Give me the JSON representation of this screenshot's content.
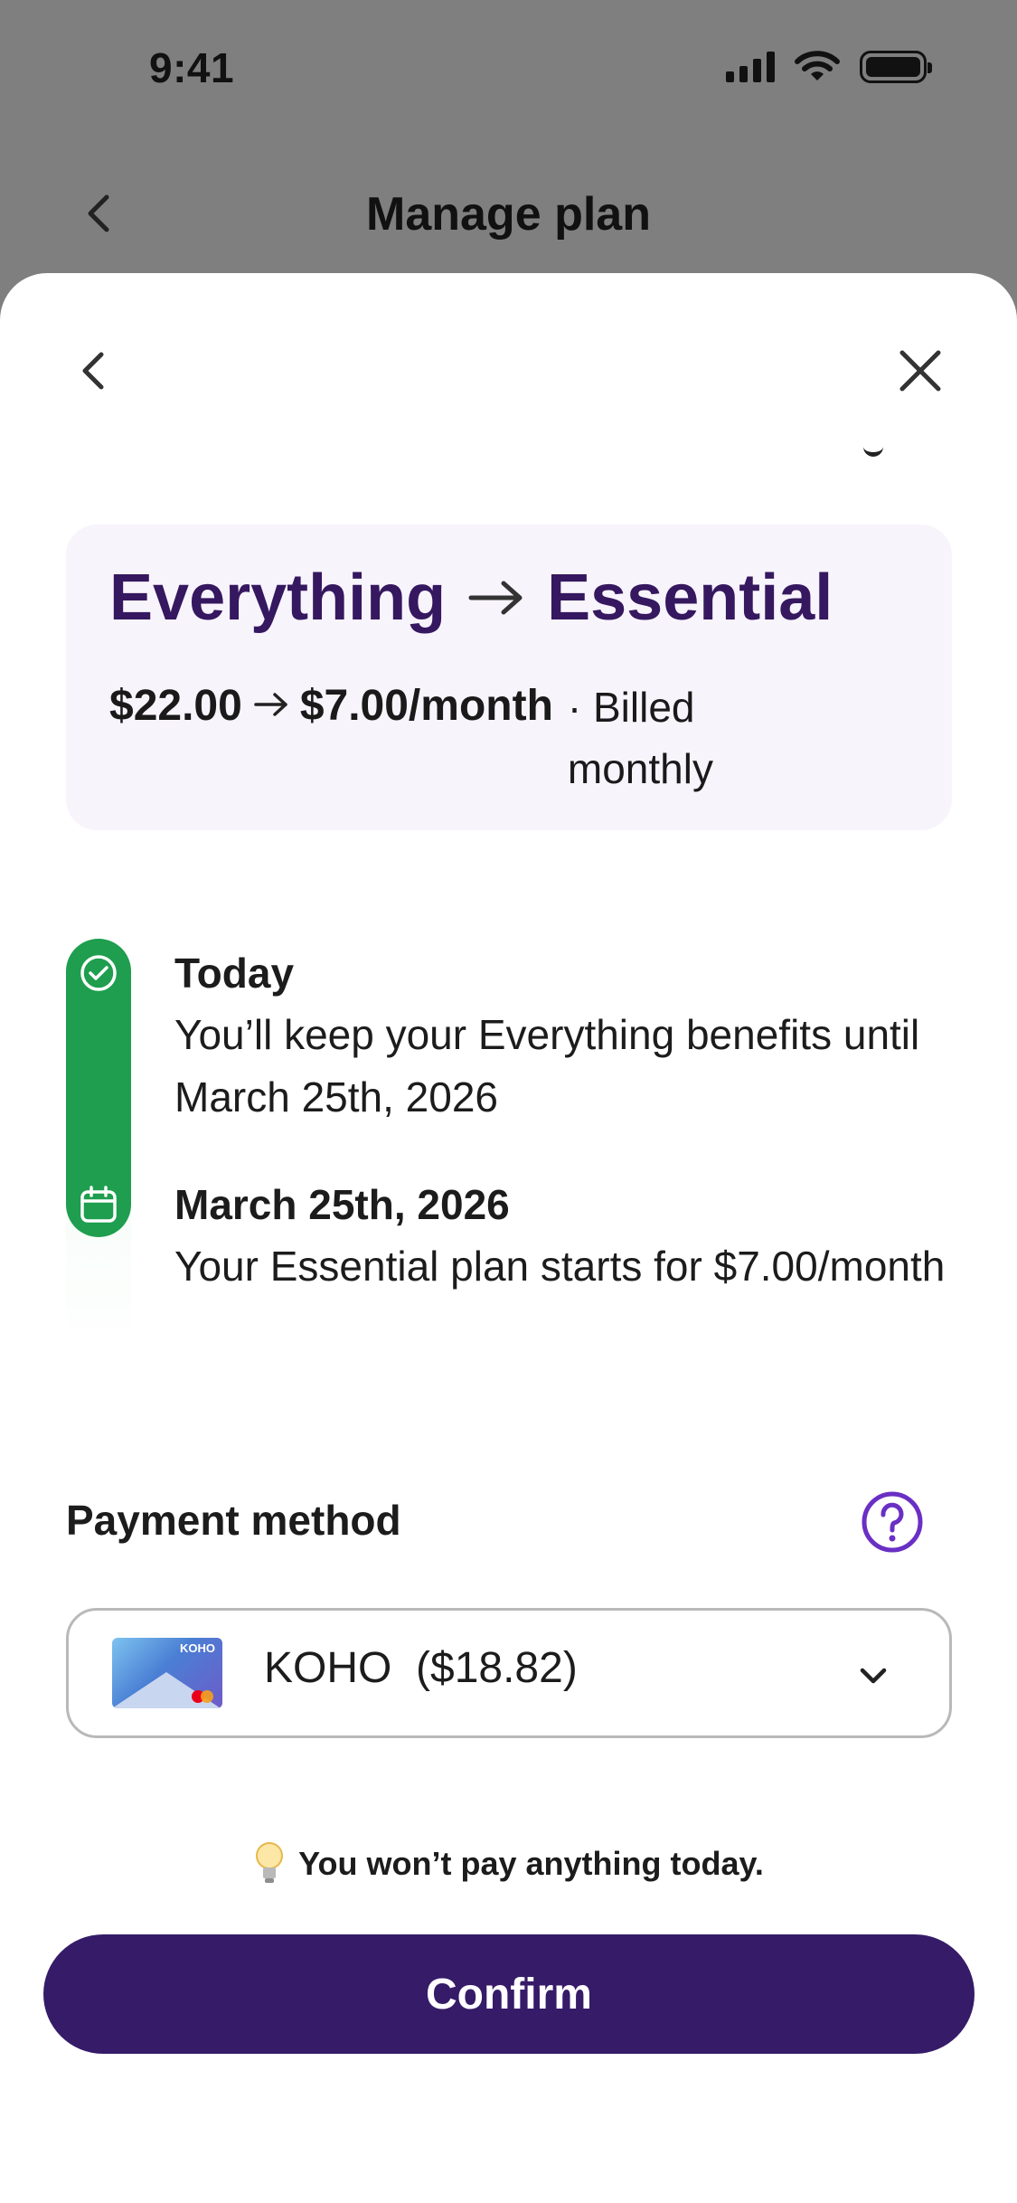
{
  "status_bar": {
    "time": "9:41"
  },
  "background_header": {
    "title": "Manage plan"
  },
  "plan_change": {
    "from_plan": "Everything",
    "to_plan": "Essential",
    "from_price": "$22.00",
    "to_price": "$7.00/month",
    "billing": "· Billed monthly"
  },
  "timeline": [
    {
      "heading": "Today",
      "text": "You’ll keep your Everything benefits until March 25th, 2026",
      "icon": "check-circle-icon"
    },
    {
      "heading": "March 25th, 2026",
      "text": "Your Essential plan starts for $7.00/month",
      "icon": "calendar-icon"
    }
  ],
  "payment": {
    "label": "Payment method",
    "selected": "KOHO  ($18.82)",
    "card_brand": "KOHO"
  },
  "note": "You won’t pay anything today.",
  "confirm_label": "Confirm",
  "colors": {
    "accent": "#351b68",
    "plan_title": "#35185f",
    "timeline_green": "#1e9e4e",
    "help_purple": "#6a2fc4"
  }
}
